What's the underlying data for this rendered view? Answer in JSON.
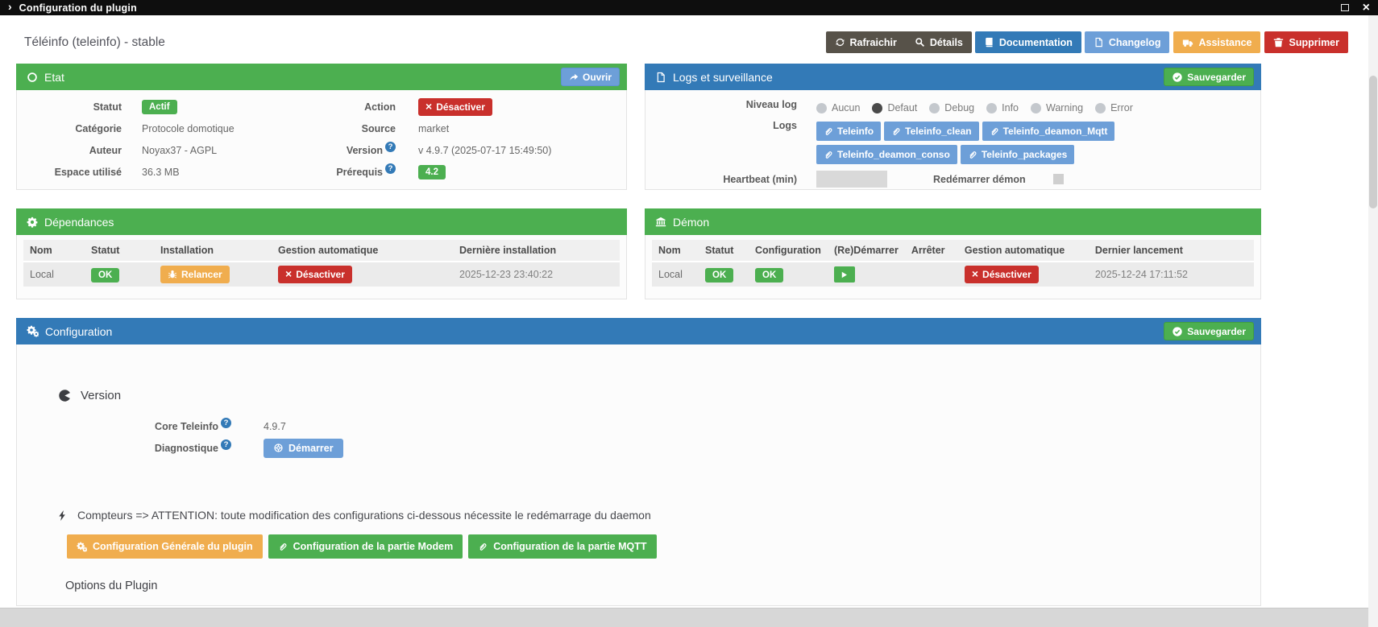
{
  "titlebar": {
    "title": "Configuration du plugin"
  },
  "page": {
    "title": "Téléinfo (teleinfo) - stable"
  },
  "toolbar": {
    "refresh": "Rafraichir",
    "details": "Détails",
    "documentation": "Documentation",
    "changelog": "Changelog",
    "assistance": "Assistance",
    "delete": "Supprimer"
  },
  "etat": {
    "title": "Etat",
    "open": "Ouvrir",
    "statut_label": "Statut",
    "statut_value": "Actif",
    "categorie_label": "Catégorie",
    "categorie_value": "Protocole domotique",
    "auteur_label": "Auteur",
    "auteur_value": "Noyax37 - AGPL",
    "espace_label": "Espace utilisé",
    "espace_value": "36.3 MB",
    "action_label": "Action",
    "action_value": "Désactiver",
    "source_label": "Source",
    "source_value": "market",
    "version_label": "Version",
    "version_value": "v 4.9.7 (2025-07-17 15:49:50)",
    "prerequis_label": "Prérequis",
    "prerequis_value": "4.2"
  },
  "logs": {
    "title": "Logs et surveillance",
    "save": "Sauvegarder",
    "niveau_label": "Niveau log",
    "levels": [
      "Aucun",
      "Defaut",
      "Debug",
      "Info",
      "Warning",
      "Error"
    ],
    "selected_level": "Defaut",
    "logs_label": "Logs",
    "files": [
      "Teleinfo",
      "Teleinfo_clean",
      "Teleinfo_deamon_Mqtt",
      "Teleinfo_deamon_conso",
      "Teleinfo_packages"
    ],
    "heartbeat_label": "Heartbeat (min)",
    "restart_label": "Redémarrer démon"
  },
  "dependances": {
    "title": "Dépendances",
    "headers": [
      "Nom",
      "Statut",
      "Installation",
      "Gestion automatique",
      "Dernière installation"
    ],
    "row": {
      "nom": "Local",
      "statut": "OK",
      "installation": "Relancer",
      "gestion": "Désactiver",
      "date": "2025-12-23 23:40:22"
    }
  },
  "demon": {
    "title": "Démon",
    "headers": [
      "Nom",
      "Statut",
      "Configuration",
      "(Re)Démarrer",
      "Arrêter",
      "Gestion automatique",
      "Dernier lancement"
    ],
    "row": {
      "nom": "Local",
      "statut": "OK",
      "configuration": "OK",
      "gestion": "Désactiver",
      "date": "2025-12-24 17:11:52"
    }
  },
  "config": {
    "title": "Configuration",
    "save": "Sauvegarder",
    "version_section": "Version",
    "core_label": "Core Teleinfo",
    "core_value": "4.9.7",
    "diag_label": "Diagnostique",
    "diag_button": "Démarrer",
    "compteurs": "Compteurs => ATTENTION: toute modification des configurations ci-dessous nécessite le redémarrage du daemon",
    "btn_general": "Configuration Générale du plugin",
    "btn_modem": "Configuration de la partie Modem",
    "btn_mqtt": "Configuration de la partie MQTT",
    "options_title": "Options du Plugin"
  },
  "colors": {
    "green": "#4caf50",
    "blue": "#337ab7",
    "light_blue": "#6d9fd8",
    "orange": "#f0ad4e",
    "red": "#c9302c",
    "dark_button": "#575249"
  }
}
